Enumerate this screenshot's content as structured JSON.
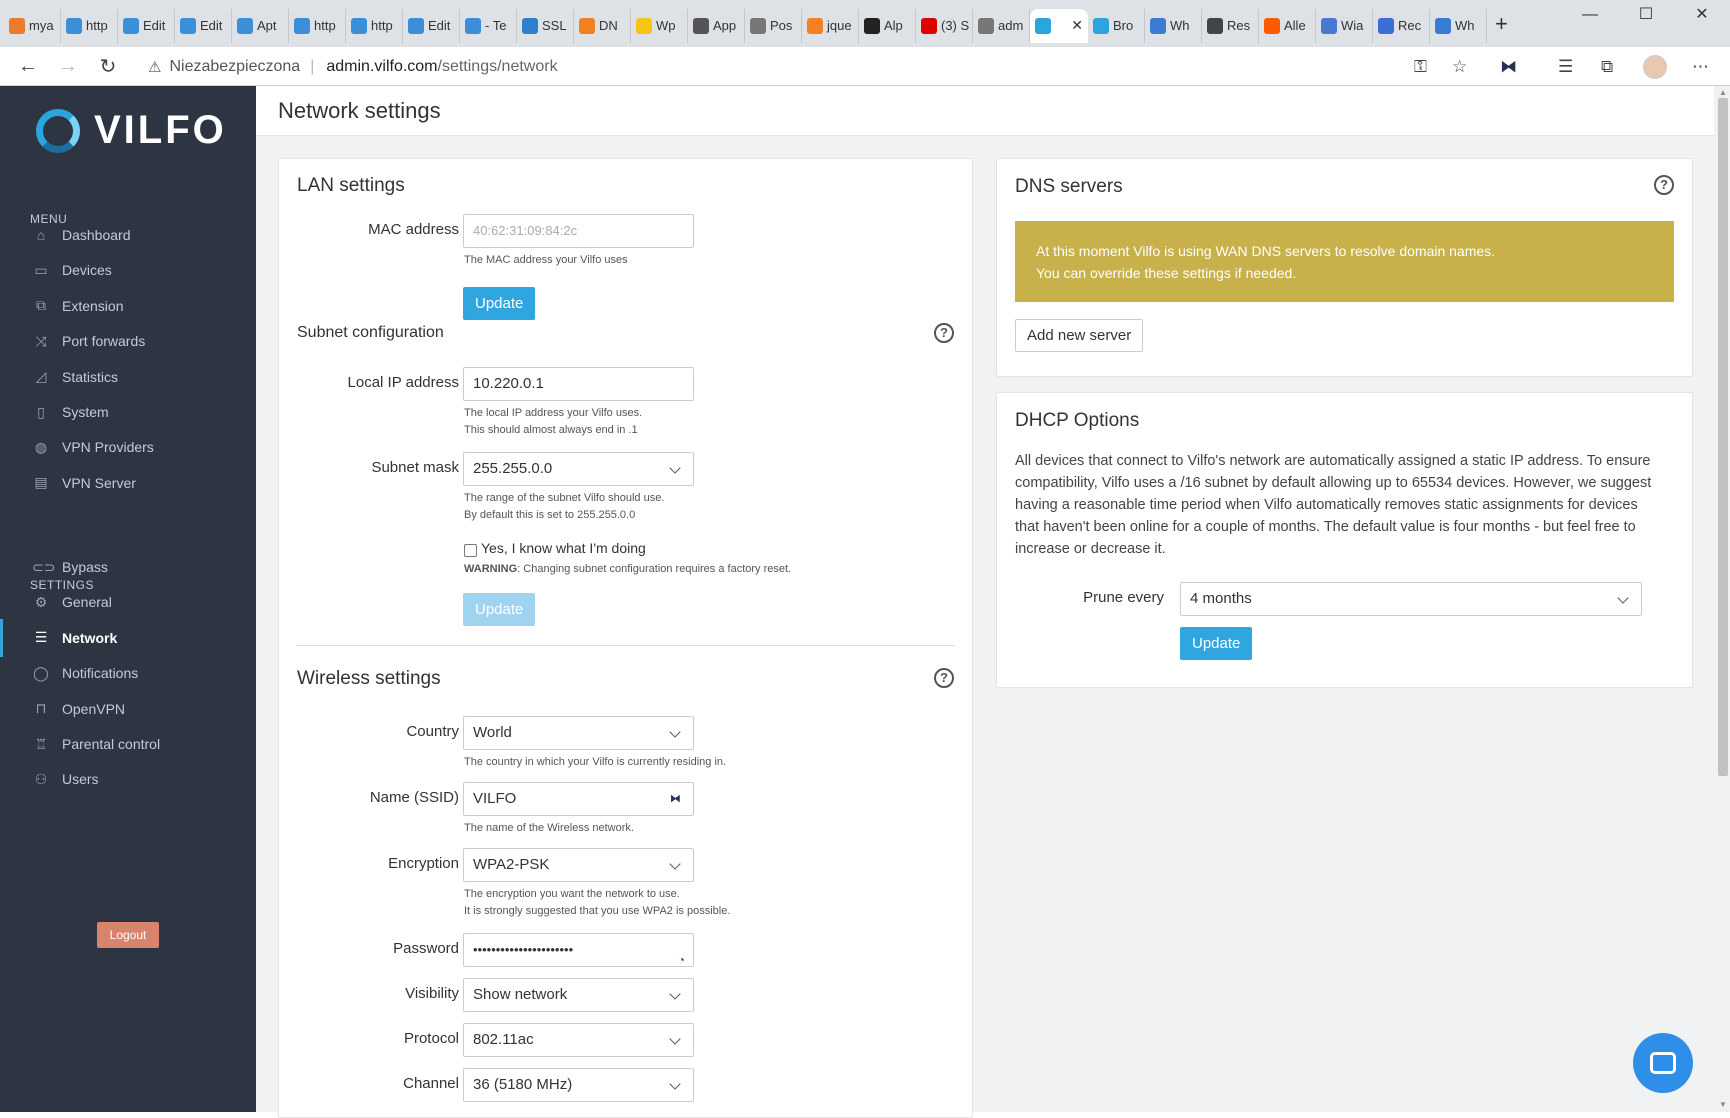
{
  "browser": {
    "tabs": [
      {
        "label": "mya",
        "icon": "phpmyadmin-icon",
        "color": "#e97b2b"
      },
      {
        "label": "http",
        "icon": "gears-icon",
        "color": "#3a8fd8"
      },
      {
        "label": "Edit",
        "icon": "gears-icon",
        "color": "#3a8fd8"
      },
      {
        "label": "Edit",
        "icon": "gears-icon",
        "color": "#3a8fd8"
      },
      {
        "label": "Apt",
        "icon": "gears-icon",
        "color": "#3a8fd8"
      },
      {
        "label": "http",
        "icon": "gears-icon",
        "color": "#3a8fd8"
      },
      {
        "label": "http",
        "icon": "gears-icon",
        "color": "#3a8fd8"
      },
      {
        "label": "Edit",
        "icon": "gears-icon",
        "color": "#3a8fd8"
      },
      {
        "label": "- Te",
        "icon": "gears-icon",
        "color": "#3a8fd8"
      },
      {
        "label": "SSL",
        "icon": "lock-icon",
        "color": "#2d7fd0"
      },
      {
        "label": "DN",
        "icon": "cloud-icon",
        "color": "#f38020"
      },
      {
        "label": "Wp",
        "icon": "lightbulb-icon",
        "color": "#f5c518"
      },
      {
        "label": "App",
        "icon": "apple-icon",
        "color": "#555555"
      },
      {
        "label": "Pos",
        "icon": "document-icon",
        "color": "#777777"
      },
      {
        "label": "jque",
        "icon": "stack-icon",
        "color": "#f48024"
      },
      {
        "label": "Alp",
        "icon": "alpine-icon",
        "color": "#222222"
      },
      {
        "label": "(3) S",
        "icon": "youtube-icon",
        "color": "#e00000"
      },
      {
        "label": "adm",
        "icon": "document-icon",
        "color": "#777777"
      },
      {
        "label": "",
        "icon": "vilfo-icon",
        "color": "#2aa5dd",
        "active": true
      },
      {
        "label": "Bro",
        "icon": "vilfo-icon",
        "color": "#2aa5dd"
      },
      {
        "label": "Wh",
        "icon": "u-icon",
        "color": "#3a7bd5"
      },
      {
        "label": "Res",
        "icon": "tools-icon",
        "color": "#444444"
      },
      {
        "label": "Alle",
        "icon": "allegro-icon",
        "color": "#ff5a00"
      },
      {
        "label": "Wia",
        "icon": "chart-icon",
        "color": "#4a77d4"
      },
      {
        "label": "Rec",
        "icon": "gear-icon",
        "color": "#3a6fd8"
      },
      {
        "label": "Wh",
        "icon": "u-icon",
        "color": "#3a7bd5"
      }
    ],
    "address": {
      "insecure_label": "Niezabezpieczona",
      "host": "admin.vilfo.com",
      "path": "/settings/network"
    }
  },
  "sidebar": {
    "logo_text": "VILFO",
    "menu_label": "MENU",
    "menu_items": [
      {
        "label": "Dashboard",
        "icon": "home-icon",
        "glyph": "⌂"
      },
      {
        "label": "Devices",
        "icon": "laptop-icon",
        "glyph": "▭"
      },
      {
        "label": "Extension",
        "icon": "puzzle-icon",
        "glyph": "⧉"
      },
      {
        "label": "Port forwards",
        "icon": "shuffle-icon",
        "glyph": "⤨"
      },
      {
        "label": "Statistics",
        "icon": "area-chart-icon",
        "glyph": "◿"
      },
      {
        "label": "System",
        "icon": "chip-icon",
        "glyph": "▯"
      },
      {
        "label": "VPN Providers",
        "icon": "globe-icon",
        "glyph": "◍"
      },
      {
        "label": "VPN Server",
        "icon": "server-icon",
        "glyph": "▤"
      }
    ],
    "settings_label": "SETTINGS",
    "settings_items": [
      {
        "label": "Bypass",
        "icon": "toggle-icon",
        "glyph": "⊂⊃"
      },
      {
        "label": "General",
        "icon": "gear-icon",
        "glyph": "⚙"
      },
      {
        "label": "Network",
        "icon": "wifi-icon",
        "glyph": "☰",
        "active": true
      },
      {
        "label": "Notifications",
        "icon": "chat-bubble-icon",
        "glyph": "◯"
      },
      {
        "label": "OpenVPN",
        "icon": "lock-icon",
        "glyph": "⊓"
      },
      {
        "label": "Parental control",
        "icon": "trophy-icon",
        "glyph": "♖"
      },
      {
        "label": "Users",
        "icon": "users-icon",
        "glyph": "⚇"
      }
    ],
    "logout_label": "Logout"
  },
  "page": {
    "title": "Network settings"
  },
  "lan": {
    "title": "LAN settings",
    "mac_label": "MAC address",
    "mac_placeholder": "40:62:31:09:84:2c",
    "mac_hint": "The MAC address your Vilfo uses",
    "update_label": "Update",
    "subnet_title": "Subnet configuration",
    "ip_label": "Local IP address",
    "ip_value": "10.220.0.1",
    "ip_hint_1": "The local IP address your Vilfo uses.",
    "ip_hint_2": "This should almost always end in .1",
    "mask_label": "Subnet mask",
    "mask_value": "255.255.0.0",
    "mask_hint_1": "The range of the subnet Vilfo should use.",
    "mask_hint_2": "By default this is set to 255.255.0.0",
    "confirm_label": "Yes, I know what I'm doing",
    "warning_strong": "WARNING",
    "warning_text": ": Changing subnet configuration requires a factory reset.",
    "subnet_update_label": "Update"
  },
  "wireless": {
    "title": "Wireless settings",
    "country_label": "Country",
    "country_value": "World",
    "country_hint": "The country in which your Vilfo is currently residing in.",
    "ssid_label": "Name (SSID)",
    "ssid_value": "VILFO",
    "ssid_hint": "The name of the Wireless network.",
    "enc_label": "Encryption",
    "enc_value": "WPA2-PSK",
    "enc_hint_1": "The encryption you want the network to use.",
    "enc_hint_2": "It is strongly suggested that you use WPA2 is possible.",
    "pw_label": "Password",
    "pw_value": "••••••••••••••••••••••",
    "vis_label": "Visibility",
    "vis_value": "Show network",
    "proto_label": "Protocol",
    "proto_value": "802.11ac",
    "chan_label": "Channel",
    "chan_value": "36 (5180 MHz)"
  },
  "dns": {
    "title": "DNS servers",
    "alert_1": "At this moment Vilfo is using WAN DNS servers to resolve domain names.",
    "alert_2": "You can override these settings if needed.",
    "add_label": "Add new server"
  },
  "dhcp": {
    "title": "DHCP Options",
    "desc_1": "All devices that connect to Vilfo's network are automatically assigned a static IP address. To ensure",
    "desc_2": "compatibility, Vilfo uses a /16 subnet by default allowing up to 65534 devices. However, we suggest",
    "desc_3": "having a reasonable time period when Vilfo automatically removes static assignments for devices",
    "desc_4": "that haven't been online for a couple of months. The default value is four months - but feel free to",
    "desc_5": "increase or decrease it.",
    "prune_label": "Prune every",
    "prune_value": "4 months",
    "update_label": "Update"
  }
}
